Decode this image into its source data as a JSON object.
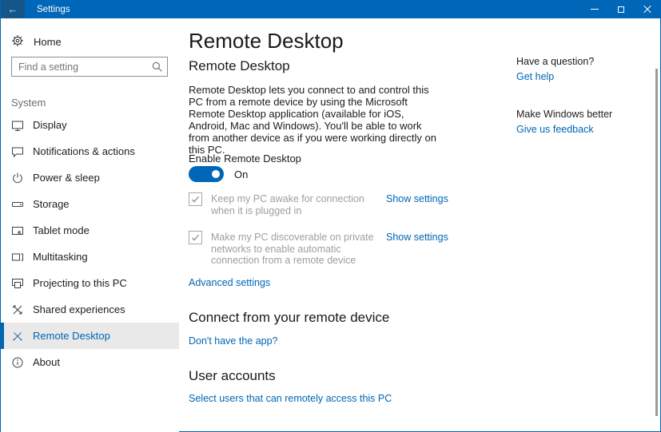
{
  "window": {
    "title": "Settings",
    "back_glyph": "←"
  },
  "sidebar": {
    "home_label": "Home",
    "search_placeholder": "Find a setting",
    "section_label": "System",
    "items": [
      {
        "label": "Display",
        "icon": "display-icon",
        "selected": false
      },
      {
        "label": "Notifications & actions",
        "icon": "notifications-icon",
        "selected": false
      },
      {
        "label": "Power & sleep",
        "icon": "power-icon",
        "selected": false
      },
      {
        "label": "Storage",
        "icon": "storage-icon",
        "selected": false
      },
      {
        "label": "Tablet mode",
        "icon": "tablet-icon",
        "selected": false
      },
      {
        "label": "Multitasking",
        "icon": "multitasking-icon",
        "selected": false
      },
      {
        "label": "Projecting to this PC",
        "icon": "projecting-icon",
        "selected": false
      },
      {
        "label": "Shared experiences",
        "icon": "shared-experiences-icon",
        "selected": false
      },
      {
        "label": "Remote Desktop",
        "icon": "remote-desktop-icon",
        "selected": true
      },
      {
        "label": "About",
        "icon": "about-icon",
        "selected": false
      }
    ]
  },
  "main": {
    "page_title": "Remote Desktop",
    "remote_desktop": {
      "heading": "Remote Desktop",
      "description": "Remote Desktop lets you connect to and control this PC from a remote device by using the Microsoft Remote Desktop application (available for iOS, Android, Mac and Windows). You'll be able to work from another device as if you were working directly on this PC.",
      "toggle_label": "Enable Remote Desktop",
      "toggle_state": "On",
      "checkboxes": [
        {
          "label": "Keep my PC awake for connection when it is plugged in",
          "checked": true,
          "link": "Show settings"
        },
        {
          "label": "Make my PC discoverable on private networks to enable automatic connection from a remote device",
          "checked": true,
          "link": "Show settings"
        }
      ],
      "advanced_link": "Advanced settings"
    },
    "connect_section": {
      "heading": "Connect from your remote device",
      "link": "Don't have the app?"
    },
    "user_accounts_section": {
      "heading": "User accounts",
      "link": "Select users that can remotely access this PC"
    }
  },
  "aside": {
    "question_heading": "Have a question?",
    "question_link": "Get help",
    "feedback_heading": "Make Windows better",
    "feedback_link": "Give us feedback"
  },
  "colors": {
    "accent": "#0067b8",
    "link": "#0066b4",
    "selected_item_bg": "#e9e9e9",
    "disabled_text": "#9e9e9e"
  }
}
